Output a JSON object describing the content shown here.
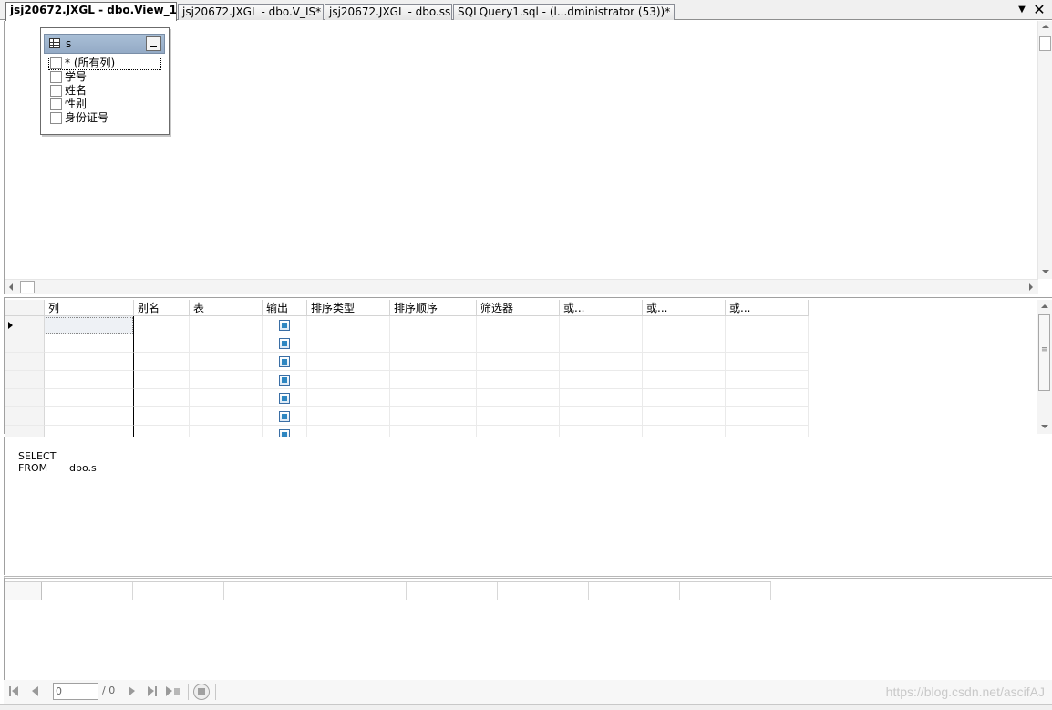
{
  "tabs": [
    {
      "label": "jsj20672.JXGL - dbo.View_1*",
      "active": true
    },
    {
      "label": "jsj20672.JXGL - dbo.V_IS*",
      "active": false
    },
    {
      "label": "jsj20672.JXGL - dbo.ss",
      "active": false
    },
    {
      "label": "SQLQuery1.sql - (l...dministrator (53))*",
      "active": false
    }
  ],
  "tab_controls": {
    "dropdown": "▼",
    "close": "✕"
  },
  "diagram": {
    "table": {
      "name": "s",
      "columns": [
        {
          "label": "* (所有列)",
          "checked": false
        },
        {
          "label": "学号",
          "checked": false
        },
        {
          "label": "姓名",
          "checked": false
        },
        {
          "label": "性别",
          "checked": false
        },
        {
          "label": "身份证号",
          "checked": false
        }
      ]
    }
  },
  "grid": {
    "headers": [
      "",
      "列",
      "别名",
      "表",
      "输出",
      "排序类型",
      "排序顺序",
      "筛选器",
      "或...",
      "或...",
      "或..."
    ],
    "rows": 7
  },
  "sql": {
    "lines": [
      {
        "keyword": "SELECT",
        "value": ""
      },
      {
        "keyword": "FROM",
        "value": "dbo.s"
      }
    ]
  },
  "navigator": {
    "current": "0",
    "total": "/ 0"
  },
  "watermark": "https://blog.csdn.net/ascifAJ"
}
